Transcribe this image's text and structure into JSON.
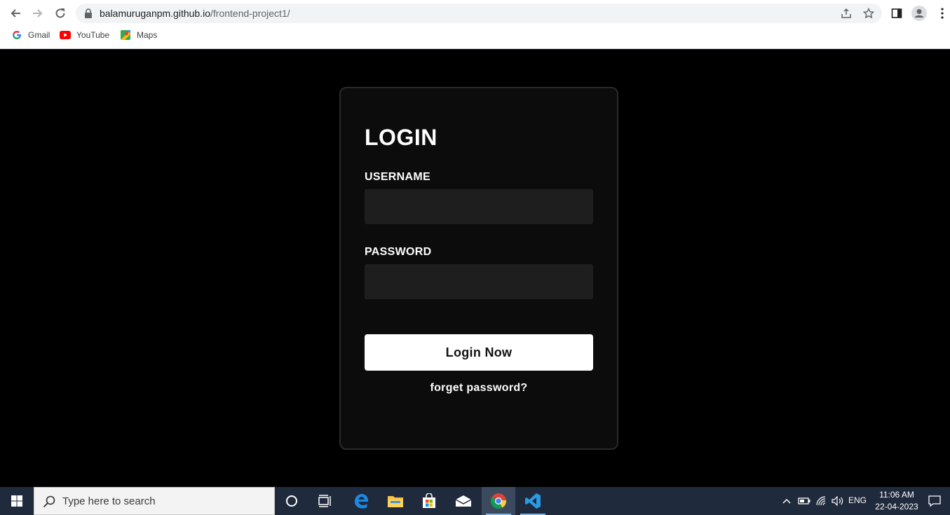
{
  "browser": {
    "url_domain": "balamuruganpm.github.io",
    "url_path": "/frontend-project1/",
    "bookmarks": [
      {
        "label": "Gmail",
        "icon": "google-icon"
      },
      {
        "label": "YouTube",
        "icon": "youtube-icon"
      },
      {
        "label": "Maps",
        "icon": "maps-icon"
      }
    ]
  },
  "login": {
    "title": "LOGIN",
    "username_label": "USERNAME",
    "username_value": "",
    "password_label": "PASSWORD",
    "password_value": "",
    "button_label": "Login Now",
    "forget_label": "forget password?"
  },
  "taskbar": {
    "search_placeholder": "Type here to search",
    "language": "ENG",
    "time": "11:06 AM",
    "date": "22-04-2023"
  },
  "colors": {
    "page_background": "#000000",
    "card_background": "#0c0c0c",
    "input_background": "#1e1e1e",
    "button_background": "#ffffff",
    "taskbar_background": "#1f2a3c"
  }
}
